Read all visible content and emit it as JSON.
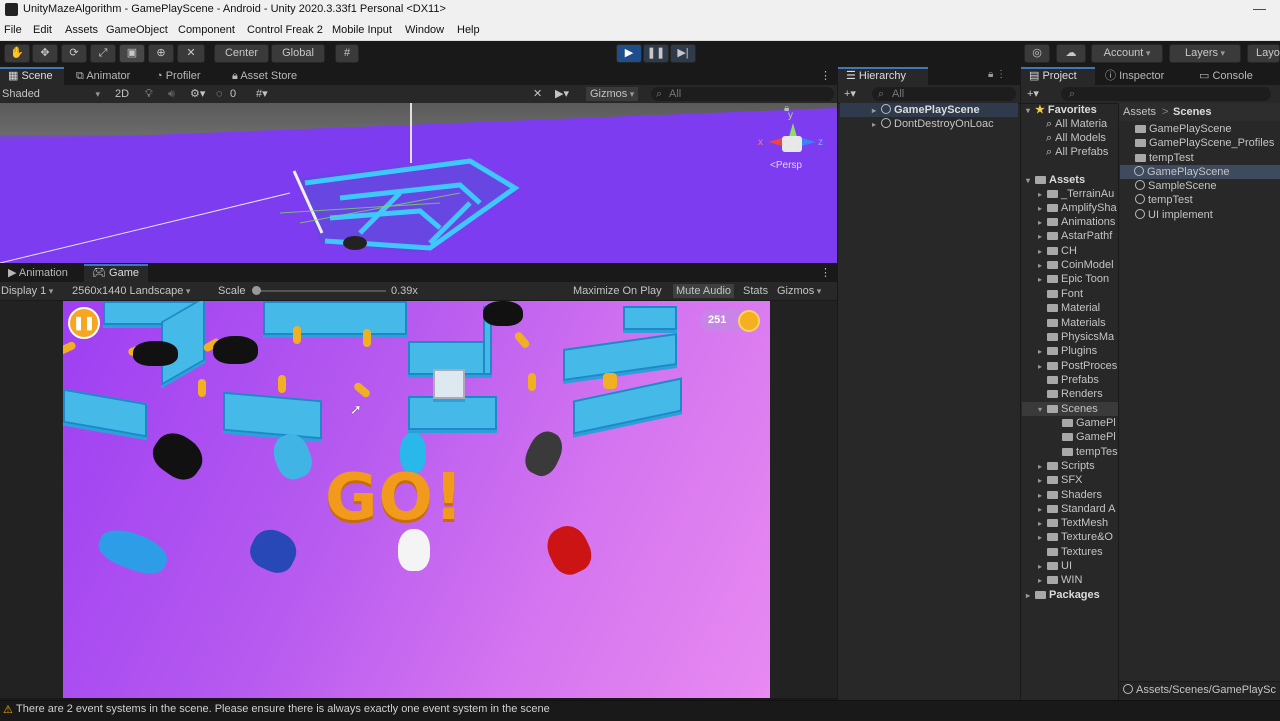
{
  "window": {
    "title": "UnityMazeAlgorithm - GamePlayScene - Android - Unity 2020.3.33f1 Personal <DX11>"
  },
  "menu": [
    "File",
    "Edit",
    "Assets",
    "GameObject",
    "Component",
    "Control Freak 2",
    "Mobile Input",
    "Window",
    "Help"
  ],
  "toolbar": {
    "center": "Center",
    "global": "Global",
    "account": "Account",
    "layers": "Layers",
    "layout": "Layo"
  },
  "scene_tabs": {
    "scene": "Scene",
    "animator": "Animator",
    "profiler": "Profiler",
    "asset_store": "Asset Store"
  },
  "scene_bar": {
    "shaded": "Shaded",
    "mode2d": "2D",
    "fx_count": "0",
    "gizmos": "Gizmos",
    "search": "All",
    "persp": "<Persp",
    "axis_x": "x",
    "axis_y": "y",
    "axis_z": "z"
  },
  "game_tabs": {
    "animation": "Animation",
    "game": "Game"
  },
  "game_bar": {
    "display": "Display 1",
    "resolution": "2560x1440 Landscape",
    "scale_label": "Scale",
    "scale_value": "0.39x",
    "maximize": "Maximize On Play",
    "mute": "Mute Audio",
    "stats": "Stats",
    "gizmos": "Gizmos"
  },
  "game": {
    "coin_count": "251",
    "go_text": "GO!"
  },
  "hierarchy": {
    "tab": "Hierarchy",
    "search": "All",
    "items": [
      "GamePlayScene",
      "DontDestroyOnLoac"
    ]
  },
  "right_tabs": {
    "project": "Project",
    "inspector": "Inspector",
    "console": "Console"
  },
  "favorites": {
    "label": "Favorites",
    "items": [
      "All Materia",
      "All Models",
      "All Prefabs"
    ]
  },
  "assets_tree": {
    "label": "Assets",
    "items": [
      "_TerrainAu",
      "AmplifySha",
      "Animations",
      "AstarPathf",
      "CH",
      "CoinModel",
      "Epic Toon",
      "Font",
      "Material",
      "Materials",
      "PhysicsMa",
      "Plugins",
      "PostProces",
      "Prefabs",
      "Renders",
      "Scenes",
      "Scripts",
      "SFX",
      "Shaders",
      "Standard A",
      "TextMesh",
      "Texture&O",
      "Textures",
      "UI",
      "WIN"
    ],
    "scenes_children": [
      "GamePl",
      "GamePl",
      "tempTes"
    ],
    "packages": "Packages"
  },
  "breadcrumb": {
    "root": "Assets",
    "sep": ">",
    "current": "Scenes"
  },
  "scene_files": [
    "GamePlayScene",
    "GamePlayScene_Profiles",
    "tempTest",
    "GamePlayScene",
    "SampleScene",
    "tempTest",
    "UI implement"
  ],
  "path_bar": "Assets/Scenes/GamePlaySc",
  "status": "There are 2 event systems in the scene. Please ensure there is always exactly one event system in the scene",
  "colors": {
    "accent": "#3a79bb",
    "purple": "#7e3bf0",
    "maze": "#45b9e8",
    "coin": "#f0b022",
    "go": "#f29a1c"
  }
}
